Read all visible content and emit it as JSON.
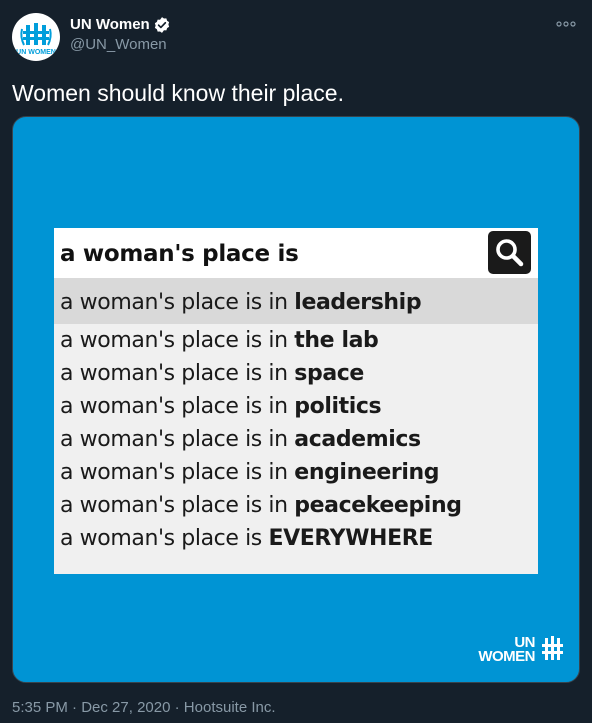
{
  "tweet": {
    "author": {
      "display_name": "UN Women",
      "handle": "@UN_Women",
      "verified_icon": "verified-badge-icon",
      "avatar_text": "UN WOMEN"
    },
    "text": "Women should know their place.",
    "image": {
      "query": "a woman's place is",
      "search_icon": "search-icon",
      "suggestions": [
        {
          "prefix": "a woman's place is in ",
          "bold": "leadership",
          "highlighted": true
        },
        {
          "prefix": "a woman's place is in ",
          "bold": "the lab"
        },
        {
          "prefix": "a woman's place is in ",
          "bold": "space"
        },
        {
          "prefix": "a woman's place is in ",
          "bold": "politics"
        },
        {
          "prefix": "a woman's place is in ",
          "bold": "academics"
        },
        {
          "prefix": "a woman's place is in ",
          "bold": "engineering"
        },
        {
          "prefix": "a woman's place is in ",
          "bold": "peacekeeping"
        },
        {
          "prefix": "a woman's place is ",
          "bold": "EVERYWHERE"
        }
      ],
      "logo_line1": "UN",
      "logo_line2": "WOMEN"
    },
    "meta": {
      "time": "5:35 PM",
      "separator": " · ",
      "date": "Dec 27, 2020",
      "source": "Hootsuite Inc."
    }
  },
  "colors": {
    "background": "#15202b",
    "media_blue": "#0094d4",
    "verified_fill": "#ffffff",
    "secondary_text": "#8899a6"
  }
}
